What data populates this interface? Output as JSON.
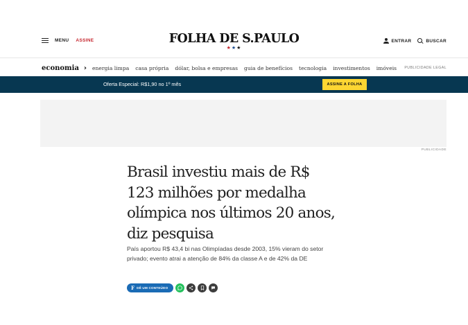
{
  "header": {
    "menu_label": "MENU",
    "assine_label": "ASSINE",
    "logo": "FOLHA DE S.PAULO",
    "stars": [
      "★",
      "★",
      "★"
    ],
    "entrar_label": "ENTRAR",
    "buscar_label": "BUSCAR"
  },
  "section_nav": {
    "title": "economia",
    "chevron": "›",
    "links": [
      "energia limpa",
      "casa própria",
      "dólar, bolsa e empresas",
      "guia de benefícios",
      "tecnologia",
      "investimentos",
      "imóveis"
    ],
    "ad_label": "PUBLICIDADE LEGAL"
  },
  "offer_bar": {
    "text": "Oferta Especial: R$1,90 no 1º mês",
    "button_label": "ASSINE A FOLHA"
  },
  "ad": {
    "label": "PUBLICIDADE"
  },
  "article": {
    "headline": "Brasil investiu mais de R$ 123 milhões por medalha olímpica nos últimos 20 anos, diz pesquisa",
    "subhead": "País aportou R$ 43,4 bi nas Olimpíadas desde 2003, 15% vieram do setor privado; evento atrai a atenção de 84% da classe A e de 42% da DE",
    "gift_label": "DÊ UM CONTEÚDO",
    "gift_mark": "F"
  },
  "colors": {
    "brand_red": "#c6262e",
    "offer_bar_bg": "#073751",
    "cta_yellow": "#fdd632",
    "gift_blue": "#1a6bb5",
    "whatsapp_green": "#25c15d"
  },
  "icons": [
    "hamburger-icon",
    "user-icon",
    "search-icon",
    "whatsapp-icon",
    "share-icon",
    "bookmark-icon",
    "comment-icon"
  ]
}
